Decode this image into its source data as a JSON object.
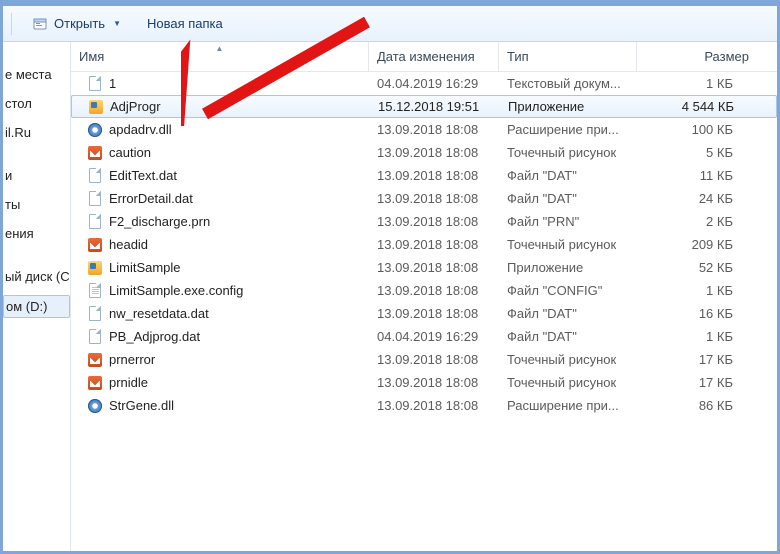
{
  "toolbar": {
    "open_label": "Открыть",
    "newfolder_label": "Новая папка"
  },
  "sidebar": {
    "items": [
      "",
      "е места",
      "стол",
      "il.Ru",
      "",
      "и",
      "ты",
      "ения",
      "",
      "ый диск (C",
      "ом (D:)"
    ],
    "selected_index": 10
  },
  "columns": {
    "name": "Имя",
    "date": "Дата изменения",
    "type": "Тип",
    "size": "Размер"
  },
  "files": [
    {
      "icon": "txt",
      "name": "1",
      "date": "04.04.2019 16:29",
      "type": "Текстовый докум...",
      "size": "1 КБ"
    },
    {
      "icon": "app",
      "name": "AdjProgr",
      "date": "15.12.2018 19:51",
      "type": "Приложение",
      "size": "4 544 КБ",
      "selected": true
    },
    {
      "icon": "gear",
      "name": "apdadrv.dll",
      "date": "13.09.2018 18:08",
      "type": "Расширение при...",
      "size": "100 КБ"
    },
    {
      "icon": "bmp",
      "name": "caution",
      "date": "13.09.2018 18:08",
      "type": "Точечный рисунок",
      "size": "5 КБ"
    },
    {
      "icon": "page",
      "name": "EditText.dat",
      "date": "13.09.2018 18:08",
      "type": "Файл \"DAT\"",
      "size": "11 КБ"
    },
    {
      "icon": "page",
      "name": "ErrorDetail.dat",
      "date": "13.09.2018 18:08",
      "type": "Файл \"DAT\"",
      "size": "24 КБ"
    },
    {
      "icon": "page",
      "name": "F2_discharge.prn",
      "date": "13.09.2018 18:08",
      "type": "Файл \"PRN\"",
      "size": "2 КБ"
    },
    {
      "icon": "bmp",
      "name": "headid",
      "date": "13.09.2018 18:08",
      "type": "Точечный рисунок",
      "size": "209 КБ"
    },
    {
      "icon": "app",
      "name": "LimitSample",
      "date": "13.09.2018 18:08",
      "type": "Приложение",
      "size": "52 КБ"
    },
    {
      "icon": "pagel",
      "name": "LimitSample.exe.config",
      "date": "13.09.2018 18:08",
      "type": "Файл \"CONFIG\"",
      "size": "1 КБ"
    },
    {
      "icon": "page",
      "name": "nw_resetdata.dat",
      "date": "13.09.2018 18:08",
      "type": "Файл \"DAT\"",
      "size": "16 КБ"
    },
    {
      "icon": "page",
      "name": "PB_Adjprog.dat",
      "date": "04.04.2019 16:29",
      "type": "Файл \"DAT\"",
      "size": "1 КБ"
    },
    {
      "icon": "bmp",
      "name": "prnerror",
      "date": "13.09.2018 18:08",
      "type": "Точечный рисунок",
      "size": "17 КБ"
    },
    {
      "icon": "bmp",
      "name": "prnidle",
      "date": "13.09.2018 18:08",
      "type": "Точечный рисунок",
      "size": "17 КБ"
    },
    {
      "icon": "gear",
      "name": "StrGene.dll",
      "date": "13.09.2018 18:08",
      "type": "Расширение при...",
      "size": "86 КБ"
    }
  ]
}
